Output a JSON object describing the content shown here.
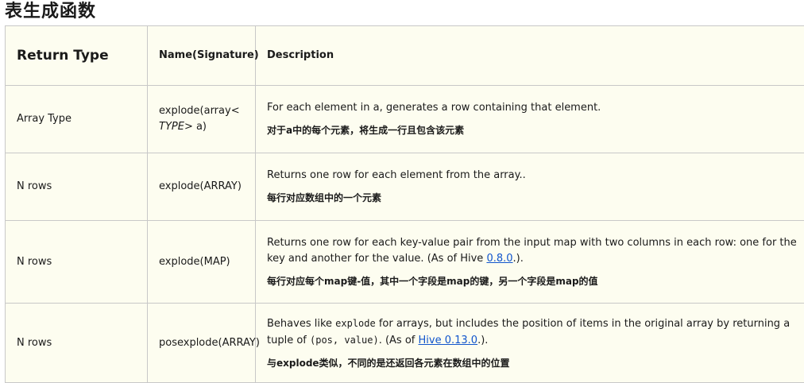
{
  "page_title": "表生成函数",
  "headers": {
    "return_type": "Return Type",
    "name": "Name(Signature)",
    "description": "Description"
  },
  "rows": [
    {
      "return_type": "Array Type",
      "name_prefix": "explode(array<",
      "name_type": "TYPE",
      "name_suffix": "> a)",
      "desc_en": "For each element in a, generates a row containing that element.",
      "desc_zh": "对于a中的每个元素，将生成一行且包含该元素"
    },
    {
      "return_type": "N rows",
      "name": "explode(ARRAY)",
      "desc_en": "Returns one row for each element from the array..",
      "desc_zh": "每行对应数组中的一个元素"
    },
    {
      "return_type": "N rows",
      "name": "explode(MAP)",
      "desc_en_1": "Returns one row for each key-value pair from the input map with two columns in each row: one for the key and another for the value. (As of Hive ",
      "desc_link": "0.8.0",
      "desc_en_2": ".).",
      "desc_zh": "每行对应每个map键-值，其中一个字段是map的键，另一个字段是map的值"
    },
    {
      "return_type": "N rows",
      "name": "posexplode(ARRAY)",
      "desc_en_1": "Behaves like ",
      "desc_code_1": "explode",
      "desc_en_2": " for arrays, but includes the position of items in the original array by returning a tuple of ",
      "desc_code_2": "(pos, value)",
      "desc_en_3": ". (As of ",
      "desc_link": "Hive 0.13.0",
      "desc_en_4": ".).",
      "desc_zh": "与explode类似，不同的是还返回各元素在数组中的位置"
    }
  ]
}
